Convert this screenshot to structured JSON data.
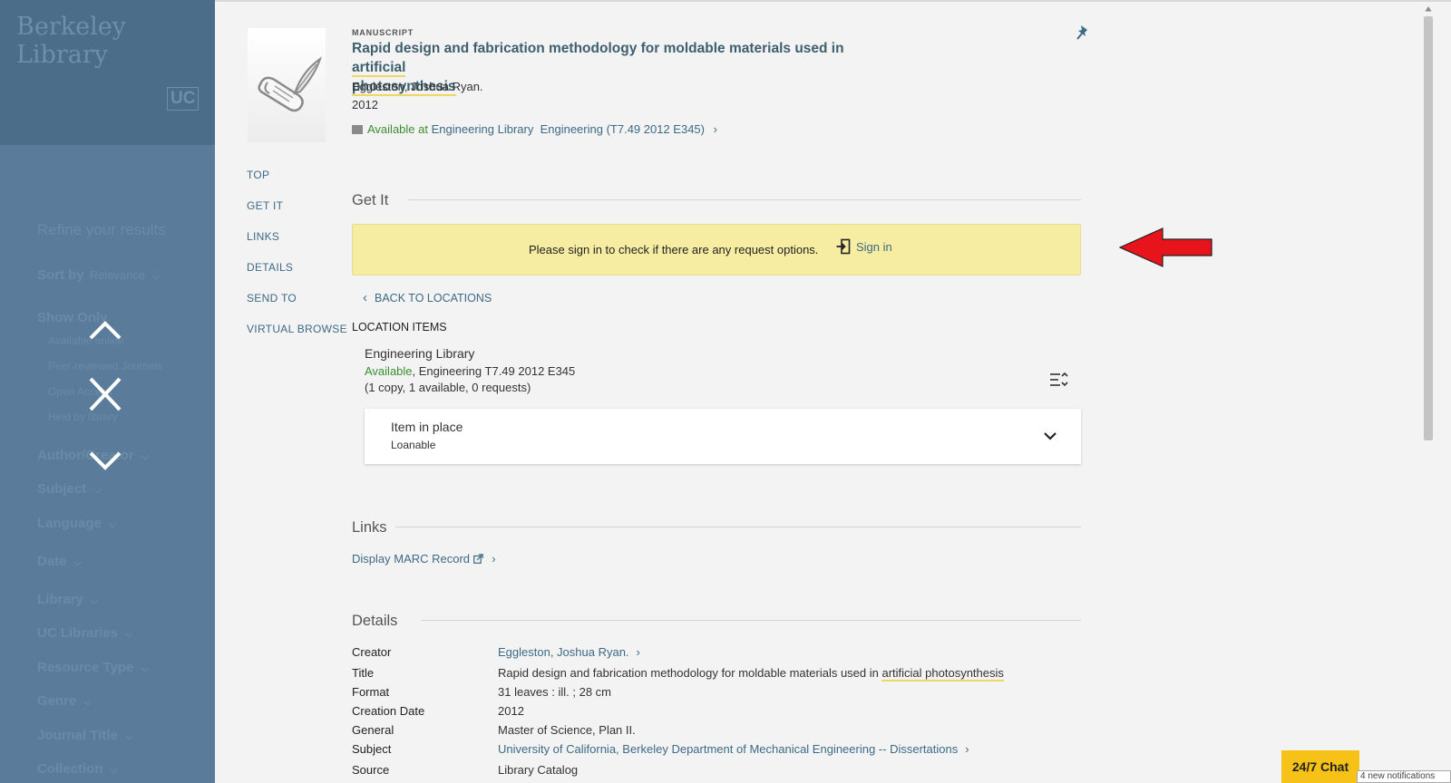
{
  "sidebar_overlay": {
    "brand": "Berkeley Library",
    "uc_mark": "UC",
    "refine_label": "Refine your results",
    "sort_by_label": "Sort by",
    "sort_by_value": "Relevance",
    "show_only_label": "Show Only",
    "show_only_items": [
      "Available online",
      "Peer-reviewed Journals",
      "Open Access",
      "Held by library"
    ],
    "facets": [
      "Author/Creator",
      "Subject",
      "Language",
      "Date",
      "Library",
      "UC Libraries",
      "Resource Type",
      "Genre",
      "Journal Title",
      "Collection"
    ]
  },
  "record": {
    "type": "MANUSCRIPT",
    "title_pre": "Rapid design and fabrication methodology for moldable materials used in ",
    "title_hl1": "artificial",
    "title_hl2": "photosynthesis",
    "author": "Eggleston, Joshua Ryan.",
    "year": "2012",
    "avail_status": "Available at",
    "avail_library": "Engineering Library",
    "avail_location": "Engineering (T7.49 2012 E345)"
  },
  "side_nav": [
    "TOP",
    "GET IT",
    "LINKS",
    "DETAILS",
    "SEND TO",
    "VIRTUAL BROWSE"
  ],
  "get_it": {
    "title": "Get It",
    "signin_message": "Please sign in to check if there are any request options.",
    "signin_button": "Sign in",
    "back_label": "BACK TO LOCATIONS",
    "location_items_label": "LOCATION ITEMS",
    "location_name": "Engineering Library",
    "location_status": "Available",
    "location_rest": ", Engineering T7.49 2012 E345",
    "location_copies": "(1 copy, 1 available, 0 requests)",
    "item_title": "Item in place",
    "item_sub": "Loanable"
  },
  "links": {
    "title": "Links",
    "marc_label": "Display MARC Record"
  },
  "details": {
    "title": "Details",
    "rows": [
      {
        "label": "Creator",
        "value": "Eggleston, Joshua Ryan."
      },
      {
        "label": "Title",
        "value_pre": "Rapid design and fabrication methodology for moldable materials used in ",
        "value_hl": "artificial photosynthesis"
      },
      {
        "label": "Format",
        "value": "31 leaves : ill. ; 28 cm"
      },
      {
        "label": "Creation Date",
        "value": "2012"
      },
      {
        "label": "General",
        "value": "Master of Science, Plan II."
      },
      {
        "label": "Subject",
        "value": "University of California, Berkeley Department of Mechanical Engineering -- Dissertations"
      },
      {
        "label": "Source",
        "value": "Library Catalog"
      }
    ]
  },
  "chat": {
    "label": "24/7 Chat",
    "notifications": "4 new notifications"
  },
  "colors": {
    "accent_link": "#3d6a85",
    "available_green": "#3b8e2f",
    "signin_bg": "#f6eda3",
    "overlay_blue": "#5a7c9a",
    "chat_yellow": "#f6c218",
    "arrow_red": "#e8141b"
  }
}
